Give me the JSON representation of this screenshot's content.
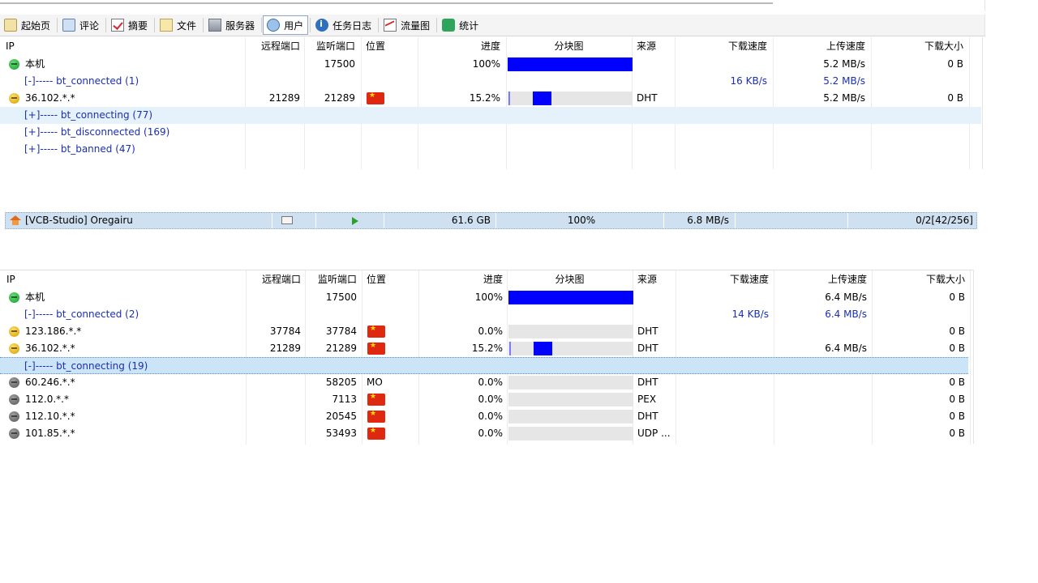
{
  "toolbar": {
    "tabs": [
      {
        "label": "起始页",
        "icon": "home-icon"
      },
      {
        "label": "评论",
        "icon": "comment-icon"
      },
      {
        "label": "摘要",
        "icon": "summary-check-icon"
      },
      {
        "label": "文件",
        "icon": "file-icon"
      },
      {
        "label": "服务器",
        "icon": "server-icon"
      },
      {
        "label": "用户",
        "icon": "users-icon",
        "active": true
      },
      {
        "label": "任务日志",
        "icon": "info-icon"
      },
      {
        "label": "流量图",
        "icon": "chart-icon"
      },
      {
        "label": "统计",
        "icon": "stats-icon"
      }
    ]
  },
  "columns": {
    "ip": "IP",
    "remote_port": "远程端口",
    "listen_port": "监听端口",
    "location": "位置",
    "progress": "进度",
    "pieces": "分块图",
    "source": "来源",
    "dl_speed": "下载速度",
    "ul_speed": "上传速度",
    "dl_size": "下载大小"
  },
  "top_panel": {
    "rows": [
      {
        "type": "peer",
        "status": "green",
        "ip": "本机",
        "remote_port": "",
        "listen_port": "17500",
        "location": "",
        "progress": "100%",
        "progress_value": 1.0,
        "source": "",
        "dl_speed": "",
        "ul_speed": "5.2 MB/s",
        "dl_size": "0 B"
      },
      {
        "type": "group",
        "label": "[-]----- bt_connected (1)",
        "dl_speed": "16 KB/s",
        "ul_speed": "5.2 MB/s"
      },
      {
        "type": "peer",
        "status": "yellow",
        "ip": "36.102.*.*",
        "remote_port": "21289",
        "listen_port": "21289",
        "location": "flag",
        "progress": "15.2%",
        "progress_value": 0.152,
        "source": "DHT",
        "dl_speed": "",
        "ul_speed": "5.2 MB/s",
        "dl_size": "0 B"
      },
      {
        "type": "group",
        "label": "[+]----- bt_connecting (77)",
        "selected": true
      },
      {
        "type": "group",
        "label": "[+]----- bt_disconnected (169)"
      },
      {
        "type": "group",
        "label": "[+]----- bt_banned (47)"
      }
    ]
  },
  "torrent": {
    "name": "[VCB-Studio] Oregairu",
    "size": "61.6 GB",
    "progress": "100%",
    "speed": "6.8 MB/s",
    "peers": "0/2[42/256]"
  },
  "bottom_panel": {
    "rows": [
      {
        "type": "peer",
        "status": "green",
        "ip": "本机",
        "remote_port": "",
        "listen_port": "17500",
        "location": "",
        "progress": "100%",
        "progress_value": 1.0,
        "source": "",
        "dl_speed": "",
        "ul_speed": "6.4 MB/s",
        "dl_size": "0 B"
      },
      {
        "type": "group",
        "label": "[-]----- bt_connected (2)",
        "dl_speed": "14 KB/s",
        "ul_speed": "6.4 MB/s"
      },
      {
        "type": "peer",
        "status": "yellow",
        "ip": "123.186.*.*",
        "remote_port": "37784",
        "listen_port": "37784",
        "location": "flag",
        "progress": "0.0%",
        "progress_value": 0.0,
        "source": "DHT",
        "dl_speed": "",
        "ul_speed": "",
        "dl_size": "0 B"
      },
      {
        "type": "peer",
        "status": "yellow",
        "ip": "36.102.*.*",
        "remote_port": "21289",
        "listen_port": "21289",
        "location": "flag",
        "progress": "15.2%",
        "progress_value": 0.152,
        "source": "DHT",
        "dl_speed": "",
        "ul_speed": "6.4 MB/s",
        "dl_size": "0 B"
      },
      {
        "type": "group",
        "label": "[-]----- bt_connecting (19)",
        "selected2": true
      },
      {
        "type": "peer",
        "status": "gray",
        "ip": "60.246.*.*",
        "remote_port": "",
        "listen_port": "58205",
        "location": "MO",
        "progress": "0.0%",
        "progress_value": 0.0,
        "source": "DHT",
        "dl_speed": "",
        "ul_speed": "",
        "dl_size": "0 B"
      },
      {
        "type": "peer",
        "status": "gray",
        "ip": "112.0.*.*",
        "remote_port": "",
        "listen_port": "7113",
        "location": "flag",
        "progress": "0.0%",
        "progress_value": 0.0,
        "source": "PEX",
        "dl_speed": "",
        "ul_speed": "",
        "dl_size": "0 B"
      },
      {
        "type": "peer",
        "status": "gray",
        "ip": "112.10.*.*",
        "remote_port": "",
        "listen_port": "20545",
        "location": "flag",
        "progress": "0.0%",
        "progress_value": 0.0,
        "source": "DHT",
        "dl_speed": "",
        "ul_speed": "",
        "dl_size": "0 B"
      },
      {
        "type": "peer",
        "status": "gray",
        "ip": "101.85.*.*",
        "remote_port": "",
        "listen_port": "53493",
        "location": "flag",
        "progress": "0.0%",
        "progress_value": 0.0,
        "source": "UDP ...",
        "dl_speed": "",
        "ul_speed": "",
        "dl_size": "0 B"
      }
    ]
  }
}
